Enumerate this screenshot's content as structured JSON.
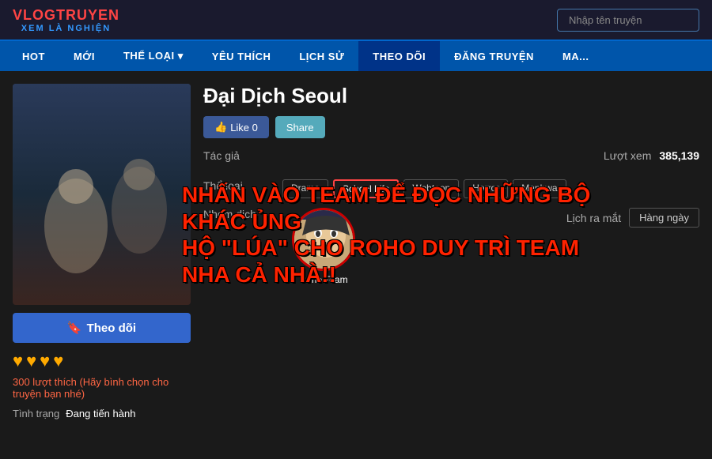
{
  "logo": {
    "top": "VLOGTRUYEN",
    "sub": "XEM LÀ NGHIỆN"
  },
  "search": {
    "placeholder": "Nhập tên truyện"
  },
  "nav": {
    "items": [
      {
        "label": "HOT",
        "id": "hot"
      },
      {
        "label": "MỚI",
        "id": "moi"
      },
      {
        "label": "THỂ LOẠI ▾",
        "id": "the-loai"
      },
      {
        "label": "YÊU THÍCH",
        "id": "yeu-thich"
      },
      {
        "label": "LỊCH SỬ",
        "id": "lich-su"
      },
      {
        "label": "THEO DÕI",
        "id": "theo-doi"
      },
      {
        "label": "ĐĂNG TRUYỆN",
        "id": "dang-truyen"
      },
      {
        "label": "MA...",
        "id": "ma"
      }
    ]
  },
  "manga": {
    "title": "Đại Dịch Seoul",
    "like_count": "Like 0",
    "share_label": "Share",
    "tac_gia_label": "Tác giả",
    "tac_gia_value": "",
    "luot_xem_label": "Lượt xem",
    "luot_xem_value": "385,139",
    "the_loai_label": "Thể loại",
    "tags": [
      "Drama",
      "School Life",
      "Webtoon",
      "Horror",
      "Manhwa"
    ],
    "nhom_dich_label": "Nhóm dịch",
    "translator_name": "Roho Team",
    "lich_ra_mat_label": "Lịch ra mắt",
    "lich_ra_mat_value": "Hàng ngày",
    "follow_label": "Theo dõi",
    "hearts": [
      "♥",
      "♥",
      "♥",
      "♥"
    ],
    "likes_count": "300 lượt thích",
    "likes_cta": "(Hãy bình chọn cho truyện bạn nhé)",
    "tinh_trang_label": "Tình trạng",
    "tinh_trang_value": "Đang tiến hành",
    "overlay_line1": "NHẤN VÀO TEAM ĐỂ ĐỌC NHỮNG BỘ KHÁC ỦNG",
    "overlay_line2": "HỘ \"LÚA\" CHO ROHO DUY TRÌ TEAM NHA CẢ NHÀ!!"
  }
}
